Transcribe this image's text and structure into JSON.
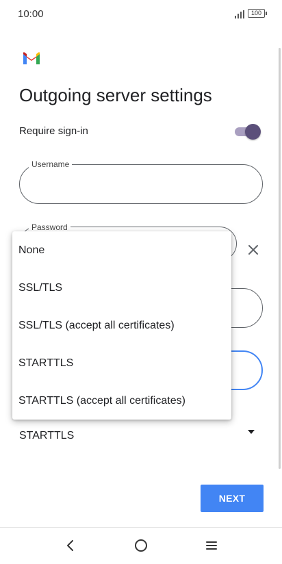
{
  "status_bar": {
    "time": "10:00",
    "battery": "100"
  },
  "app": {
    "logo": "gmail-logo",
    "colors": {
      "accent": "#4285f4",
      "toggle_thumb": "#5b4f7a",
      "toggle_track": "#a99fc0"
    }
  },
  "page": {
    "title": "Outgoing server settings"
  },
  "require_signin": {
    "label": "Require sign-in",
    "enabled": true
  },
  "fields": {
    "username": {
      "label": "Username",
      "value": ""
    },
    "password": {
      "label": "Password",
      "value": ""
    }
  },
  "security_menu": {
    "items": [
      {
        "label": "None"
      },
      {
        "label": "SSL/TLS"
      },
      {
        "label": "SSL/TLS (accept all certificates)"
      },
      {
        "label": "STARTTLS"
      },
      {
        "label": "STARTTLS (accept all certificates)"
      }
    ]
  },
  "security_type": {
    "selected": "STARTTLS"
  },
  "actions": {
    "next_label": "NEXT"
  },
  "nav_bar": {
    "icons": [
      "back-icon",
      "home-icon",
      "menu-icon"
    ]
  }
}
